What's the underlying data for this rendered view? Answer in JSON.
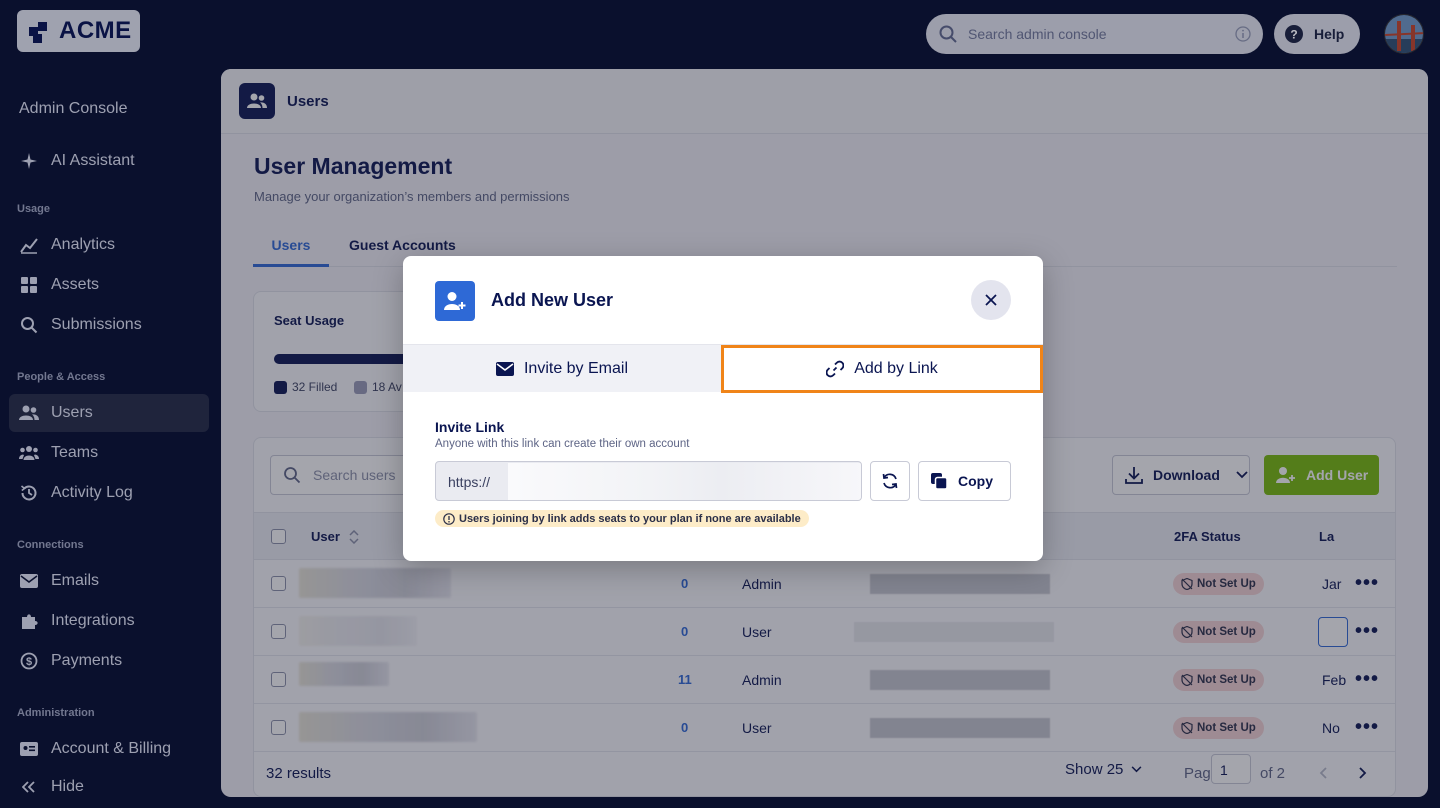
{
  "brand": {
    "name": "ACME"
  },
  "topbar": {
    "search_placeholder": "Search admin console",
    "help_label": "Help"
  },
  "sidebar": {
    "title": "Admin Console",
    "ai_label": "AI Assistant",
    "sections": {
      "usage": "Usage",
      "people": "People & Access",
      "connections": "Connections",
      "admin": "Administration"
    },
    "items": {
      "analytics": "Analytics",
      "assets": "Assets",
      "submissions": "Submissions",
      "users": "Users",
      "teams": "Teams",
      "activity": "Activity Log",
      "emails": "Emails",
      "integrations": "Integrations",
      "payments": "Payments",
      "billing": "Account & Billing",
      "hide": "Hide"
    }
  },
  "main": {
    "header_title": "Users",
    "page_title": "User Management",
    "page_subtitle": "Manage your organization’s members and permissions",
    "tabs": [
      "Users",
      "Guest Accounts"
    ],
    "seat": {
      "title": "Seat Usage",
      "filled_label": "32 Filled",
      "available_label": "18 Av",
      "filled_fraction": 0.64
    },
    "table": {
      "search_placeholder": "Search users",
      "download_label": "Download",
      "add_user_label": "Add User",
      "columns": {
        "user": "User",
        "twofa": "2FA Status",
        "last": "La"
      },
      "rows": [
        {
          "count": "0",
          "role": "Admin",
          "twofa": "Not Set Up",
          "last": "Jar"
        },
        {
          "count": "0",
          "role": "User",
          "twofa": "Not Set Up",
          "last": ""
        },
        {
          "count": "11",
          "role": "Admin",
          "twofa": "Not Set Up",
          "last": "Feb"
        },
        {
          "count": "0",
          "role": "User",
          "twofa": "Not Set Up",
          "last": "No"
        }
      ],
      "results": "32 results",
      "show_label": "Show 25",
      "page_label": "Page",
      "page_value": "1",
      "of_label": "of 2"
    }
  },
  "modal": {
    "title": "Add New User",
    "tab_email": "Invite by Email",
    "tab_link": "Add by Link",
    "invite_title": "Invite Link",
    "invite_subtitle": "Anyone with this link can create their own account",
    "link_prefix": "https://",
    "copy_label": "Copy",
    "warning": "Users joining by link adds seats to your plan if none are available"
  },
  "colors": {
    "navy": "#0a1551",
    "accent_blue": "#2e69d6",
    "green": "#78bb07",
    "highlight_orange": "#f08418"
  }
}
